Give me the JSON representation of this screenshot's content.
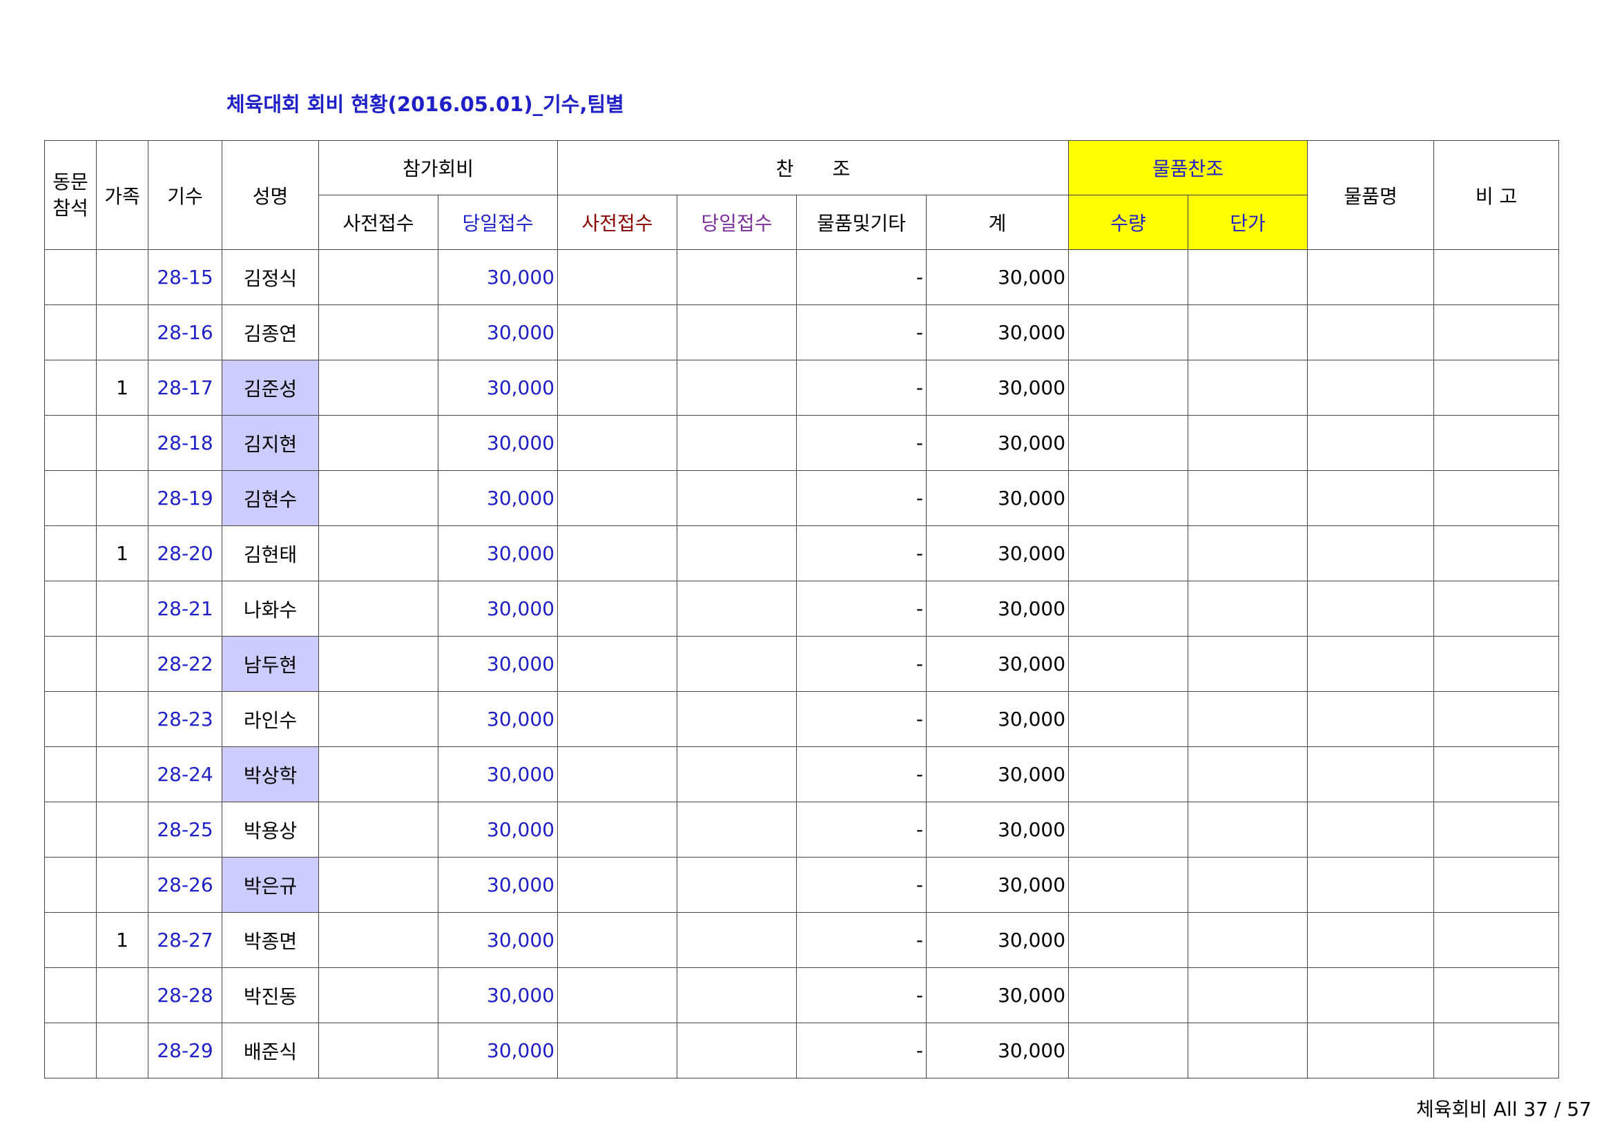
{
  "title": "체육대회 회비 현황(2016.05.01)_기수,팀별",
  "headers": {
    "col1_line1": "동문",
    "col1_line2": "참석",
    "family": "가족",
    "gisu": "기수",
    "name": "성명",
    "fee_group": "참가회비",
    "fee_pre": "사전접수",
    "fee_day": "당일접수",
    "sponsor_group": "찬　　조",
    "sp_pre": "사전접수",
    "sp_day": "당일접수",
    "sp_goods": "물품및기타",
    "sp_total": "계",
    "goods_group": "물품찬조",
    "goods_qty": "수량",
    "goods_price": "단가",
    "goods_name": "물품명",
    "remarks": "비 고"
  },
  "rows": [
    {
      "family": "",
      "gisu": "28-15",
      "name": "김정식",
      "name_hl": false,
      "fee_day": "30,000",
      "goods": "-",
      "total": "30,000"
    },
    {
      "family": "",
      "gisu": "28-16",
      "name": "김종연",
      "name_hl": false,
      "fee_day": "30,000",
      "goods": "-",
      "total": "30,000"
    },
    {
      "family": "1",
      "gisu": "28-17",
      "name": "김준성",
      "name_hl": true,
      "fee_day": "30,000",
      "goods": "-",
      "total": "30,000"
    },
    {
      "family": "",
      "gisu": "28-18",
      "name": "김지현",
      "name_hl": true,
      "fee_day": "30,000",
      "goods": "-",
      "total": "30,000"
    },
    {
      "family": "",
      "gisu": "28-19",
      "name": "김현수",
      "name_hl": true,
      "fee_day": "30,000",
      "goods": "-",
      "total": "30,000"
    },
    {
      "family": "1",
      "gisu": "28-20",
      "name": "김현태",
      "name_hl": false,
      "fee_day": "30,000",
      "goods": "-",
      "total": "30,000"
    },
    {
      "family": "",
      "gisu": "28-21",
      "name": "나화수",
      "name_hl": false,
      "fee_day": "30,000",
      "goods": "-",
      "total": "30,000"
    },
    {
      "family": "",
      "gisu": "28-22",
      "name": "남두현",
      "name_hl": true,
      "fee_day": "30,000",
      "goods": "-",
      "total": "30,000"
    },
    {
      "family": "",
      "gisu": "28-23",
      "name": "라인수",
      "name_hl": false,
      "fee_day": "30,000",
      "goods": "-",
      "total": "30,000"
    },
    {
      "family": "",
      "gisu": "28-24",
      "name": "박상학",
      "name_hl": true,
      "fee_day": "30,000",
      "goods": "-",
      "total": "30,000"
    },
    {
      "family": "",
      "gisu": "28-25",
      "name": "박용상",
      "name_hl": false,
      "fee_day": "30,000",
      "goods": "-",
      "total": "30,000"
    },
    {
      "family": "",
      "gisu": "28-26",
      "name": "박은규",
      "name_hl": true,
      "fee_day": "30,000",
      "goods": "-",
      "total": "30,000"
    },
    {
      "family": "1",
      "gisu": "28-27",
      "name": "박종면",
      "name_hl": false,
      "fee_day": "30,000",
      "goods": "-",
      "total": "30,000"
    },
    {
      "family": "",
      "gisu": "28-28",
      "name": "박진동",
      "name_hl": false,
      "fee_day": "30,000",
      "goods": "-",
      "total": "30,000"
    },
    {
      "family": "",
      "gisu": "28-29",
      "name": "배준식",
      "name_hl": false,
      "fee_day": "30,000",
      "goods": "-",
      "total": "30,000"
    }
  ],
  "footer": "체육회비 All 37 / 57",
  "colors": {
    "title": "#1f1fc8",
    "blue_text": "#1f1fc8",
    "red_text": "#8b0000",
    "purple_text": "#7b2f9c",
    "yellow_header": "#ffff00",
    "name_highlight": "#ccccff"
  }
}
